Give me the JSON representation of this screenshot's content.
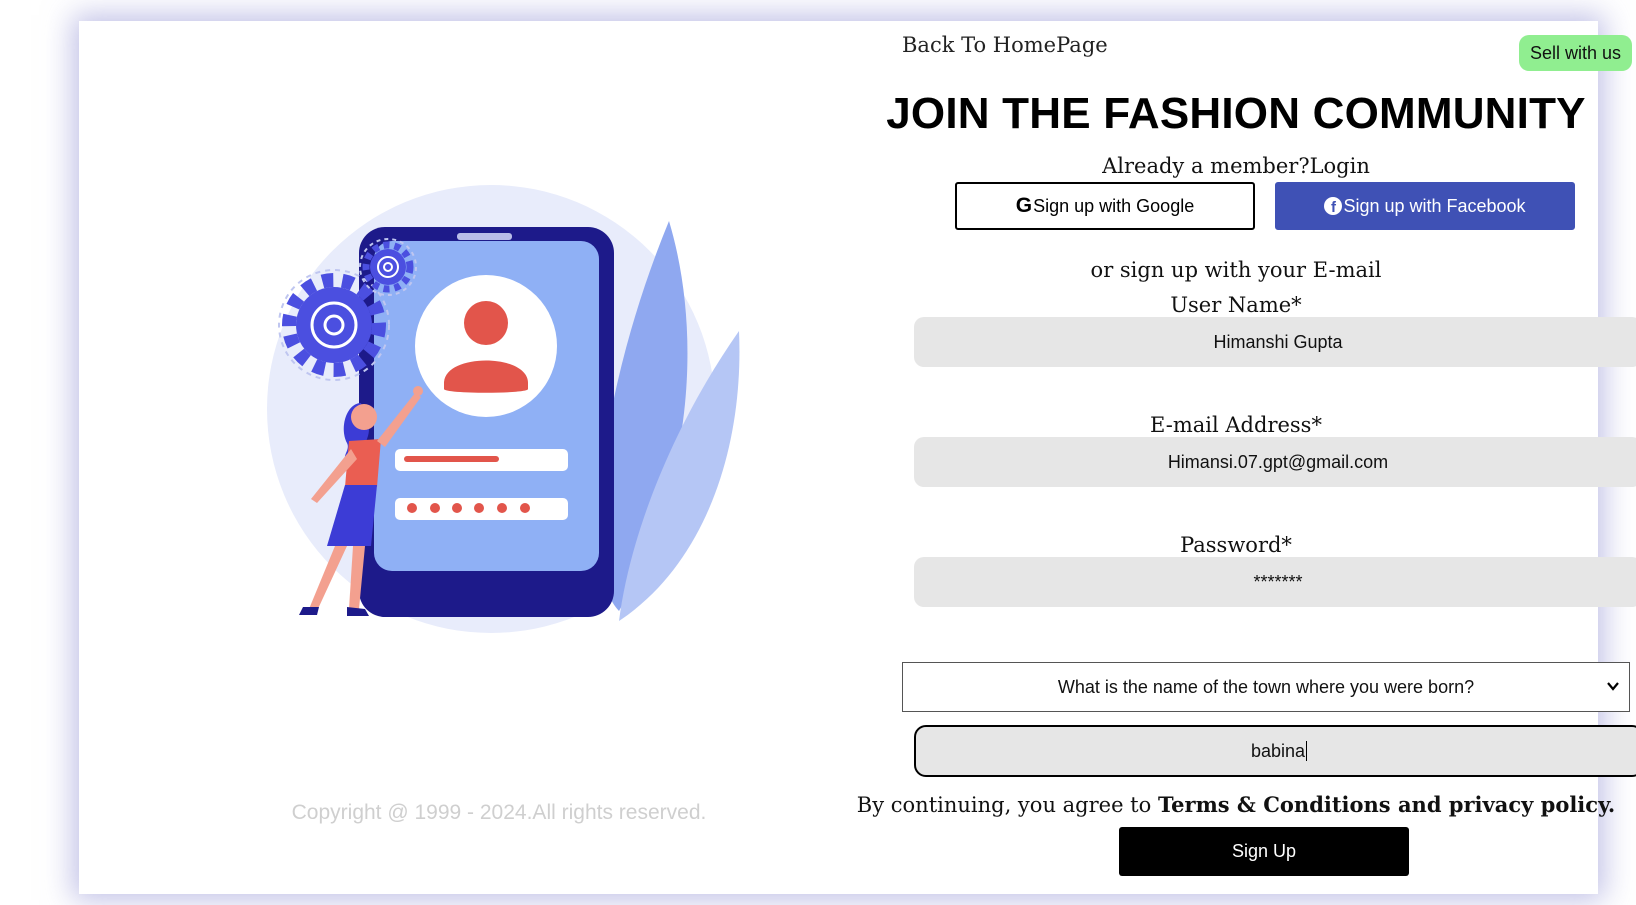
{
  "header": {
    "back_link": "Back To HomePage",
    "sell_button": "Sell with us"
  },
  "page_title": "JOIN THE FASHION COMMUNITY",
  "member_prompt": "Already a member?",
  "login_link": "Login",
  "social": {
    "google_label": "Sign up with Google",
    "google_icon": "google-icon",
    "facebook_label": "Sign up with Facebook",
    "facebook_icon": "facebook-icon"
  },
  "or_text": "or sign up with your E-mail",
  "form": {
    "username": {
      "label": "User Name*",
      "value": "Himanshi Gupta"
    },
    "email": {
      "label": "E-mail Address*",
      "value": "Himansi.07.gpt@gmail.com"
    },
    "password": {
      "label": "Password*",
      "value": "*******"
    },
    "security_question": {
      "selected": "What is the name of the town where you were born?"
    },
    "security_answer": {
      "value": "babina"
    }
  },
  "terms": {
    "prefix": "By continuing, you agree to ",
    "link": "Terms & Conditions and privacy policy."
  },
  "signup_button": "Sign Up",
  "copyright": "Copyright @ 1999 - 2024.All rights reserved.",
  "colors": {
    "sell_button_bg": "#90ee90",
    "facebook_blue": "#3f51b5",
    "input_bg": "#e6e6e6",
    "signup_bg": "#000000"
  },
  "illustration": "phone-login-illustration"
}
